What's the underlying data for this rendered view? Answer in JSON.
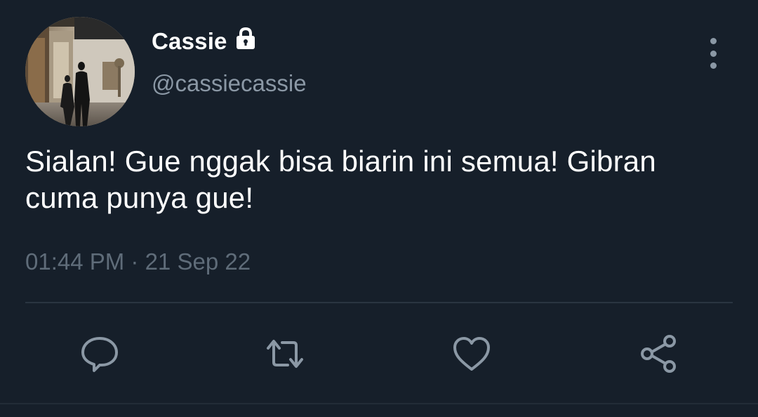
{
  "user": {
    "display_name": "Cassie",
    "handle": "@cassiecassie",
    "protected": true
  },
  "tweet": {
    "text": "Sialan! Gue nggak bisa biarin ini semua! Gibran cuma punya gue!",
    "timestamp": "01:44 PM · 21 Sep 22"
  },
  "actions": [
    "reply-icon",
    "retweet-icon",
    "like-icon",
    "share-icon"
  ],
  "colors": {
    "background": "#161f2a",
    "secondary_text": "#8b98a5",
    "timestamp_text": "#5f6c79",
    "divider": "#2a3541"
  }
}
